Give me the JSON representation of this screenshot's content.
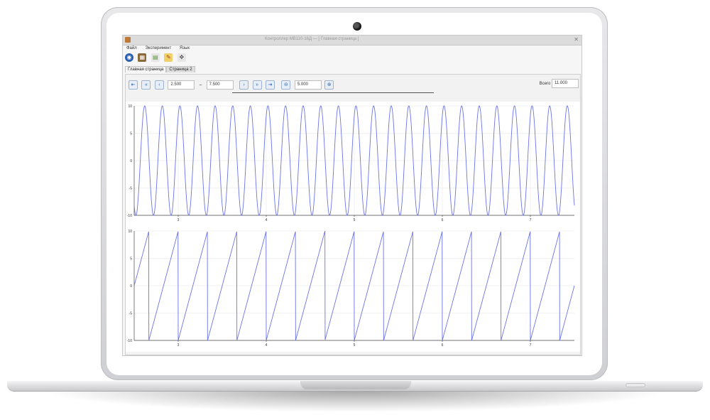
{
  "window": {
    "title": "Контроллер МВ110-16Д — [ Главная страница ]"
  },
  "menu": [
    "Файл",
    "Эксперимент",
    "Язык"
  ],
  "toolbar_icons": [
    "app-logo-icon",
    "calendar-icon",
    "document-icon",
    "brush-icon",
    "settings-icon"
  ],
  "tabs": [
    {
      "label": "Главная страница",
      "active": false
    },
    {
      "label": "Страница 2",
      "active": true
    }
  ],
  "navigation": {
    "range_start": "2.500",
    "range_end": "7.500",
    "zoom_value": "5.000",
    "total_label": "Всего",
    "total_value": "11.000"
  },
  "colors": {
    "series": "#6b74e6",
    "grid": "#e6e6e6"
  },
  "chart_data": [
    {
      "type": "line",
      "title": "",
      "xlabel": "",
      "ylabel": "",
      "xlim": [
        2.5,
        7.5
      ],
      "ylim": [
        -10,
        10
      ],
      "xticks": [
        3,
        4,
        5,
        6,
        7
      ],
      "yticks": [
        10,
        5,
        0,
        -5,
        -10
      ],
      "grid": true,
      "series": [
        {
          "waveform": "sine",
          "amplitude": 10,
          "frequency_per_unit": 5,
          "phase_deg": 55
        }
      ]
    },
    {
      "type": "line",
      "title": "",
      "xlabel": "",
      "ylabel": "",
      "xlim": [
        2.5,
        7.5
      ],
      "ylim": [
        -10,
        10
      ],
      "xticks": [
        3,
        4,
        5,
        6,
        7
      ],
      "yticks": [
        10,
        5,
        0,
        -5,
        -10
      ],
      "grid": true,
      "series": [
        {
          "waveform": "sawtooth",
          "amplitude": 10,
          "frequency_per_unit": 3
        }
      ]
    }
  ]
}
